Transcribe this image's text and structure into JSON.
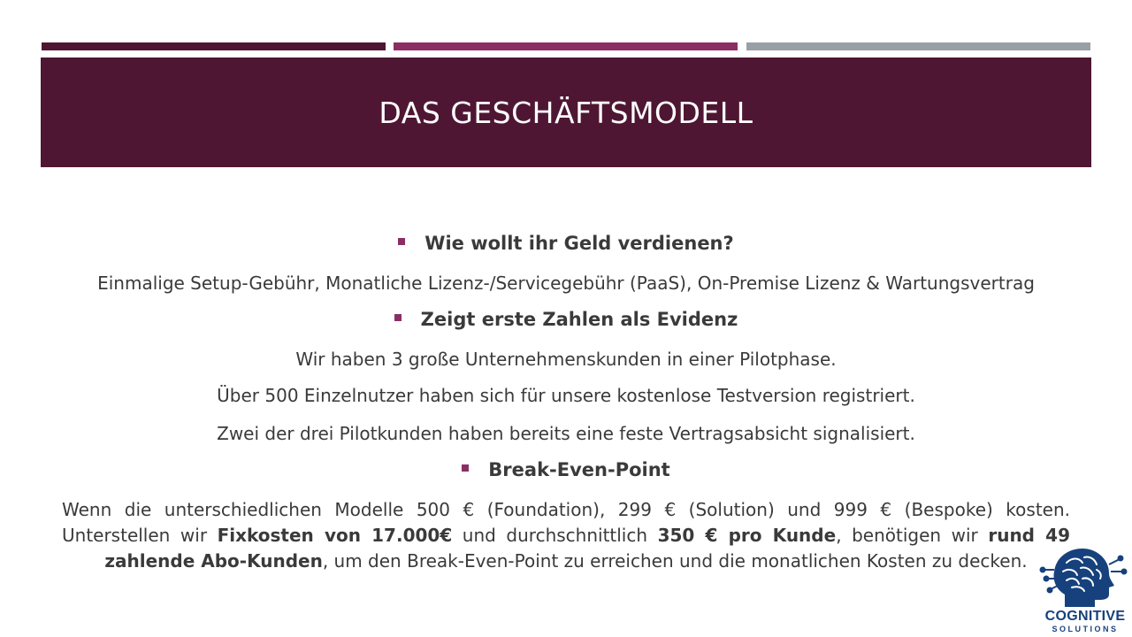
{
  "slide": {
    "title": "Das Geschäftsmodell"
  },
  "accent_colors": [
    "#4f1633",
    "#8b2f63",
    "#98a0a6"
  ],
  "sections": [
    {
      "heading": "Wie wollt ihr Geld verdienen?",
      "lines": [
        "Einmalige Setup-Gebühr, Monatliche Lizenz-/Servicegebühr (PaaS), On-Premise Lizenz & Wartungsvertrag"
      ]
    },
    {
      "heading": "Zeigt erste Zahlen als Evidenz",
      "lines": [
        "Wir haben 3 große Unternehmenskunden in einer Pilotphase.",
        "Über 500 Einzelnutzer haben sich für unsere kostenlose Testversion registriert.",
        "Zwei der drei Pilotkunden haben bereits eine feste Vertragsabsicht signalisiert."
      ]
    },
    {
      "heading": "Break-Even-Point",
      "paragraph": {
        "part1": "Wenn die unterschiedlichen Modelle 500 € (Foundation), 299 € (Solution) und 999 € (Bespoke) kosten. Unterstellen wir ",
        "bold1": "Fixkosten von 17.000€",
        "part2": " und durchschnittlich ",
        "bold2": "350 € pro Kunde",
        "part3": ", benötigen wir ",
        "bold3": "rund 49 zahlende Abo-Kunden",
        "part4": ", um den Break-Even-Point zu erreichen und die monatlichen Kosten zu decken."
      }
    }
  ],
  "logo": {
    "name": "COGNITIVE",
    "sub": "SOLUTIONS",
    "icon": "brain-head-icon"
  }
}
